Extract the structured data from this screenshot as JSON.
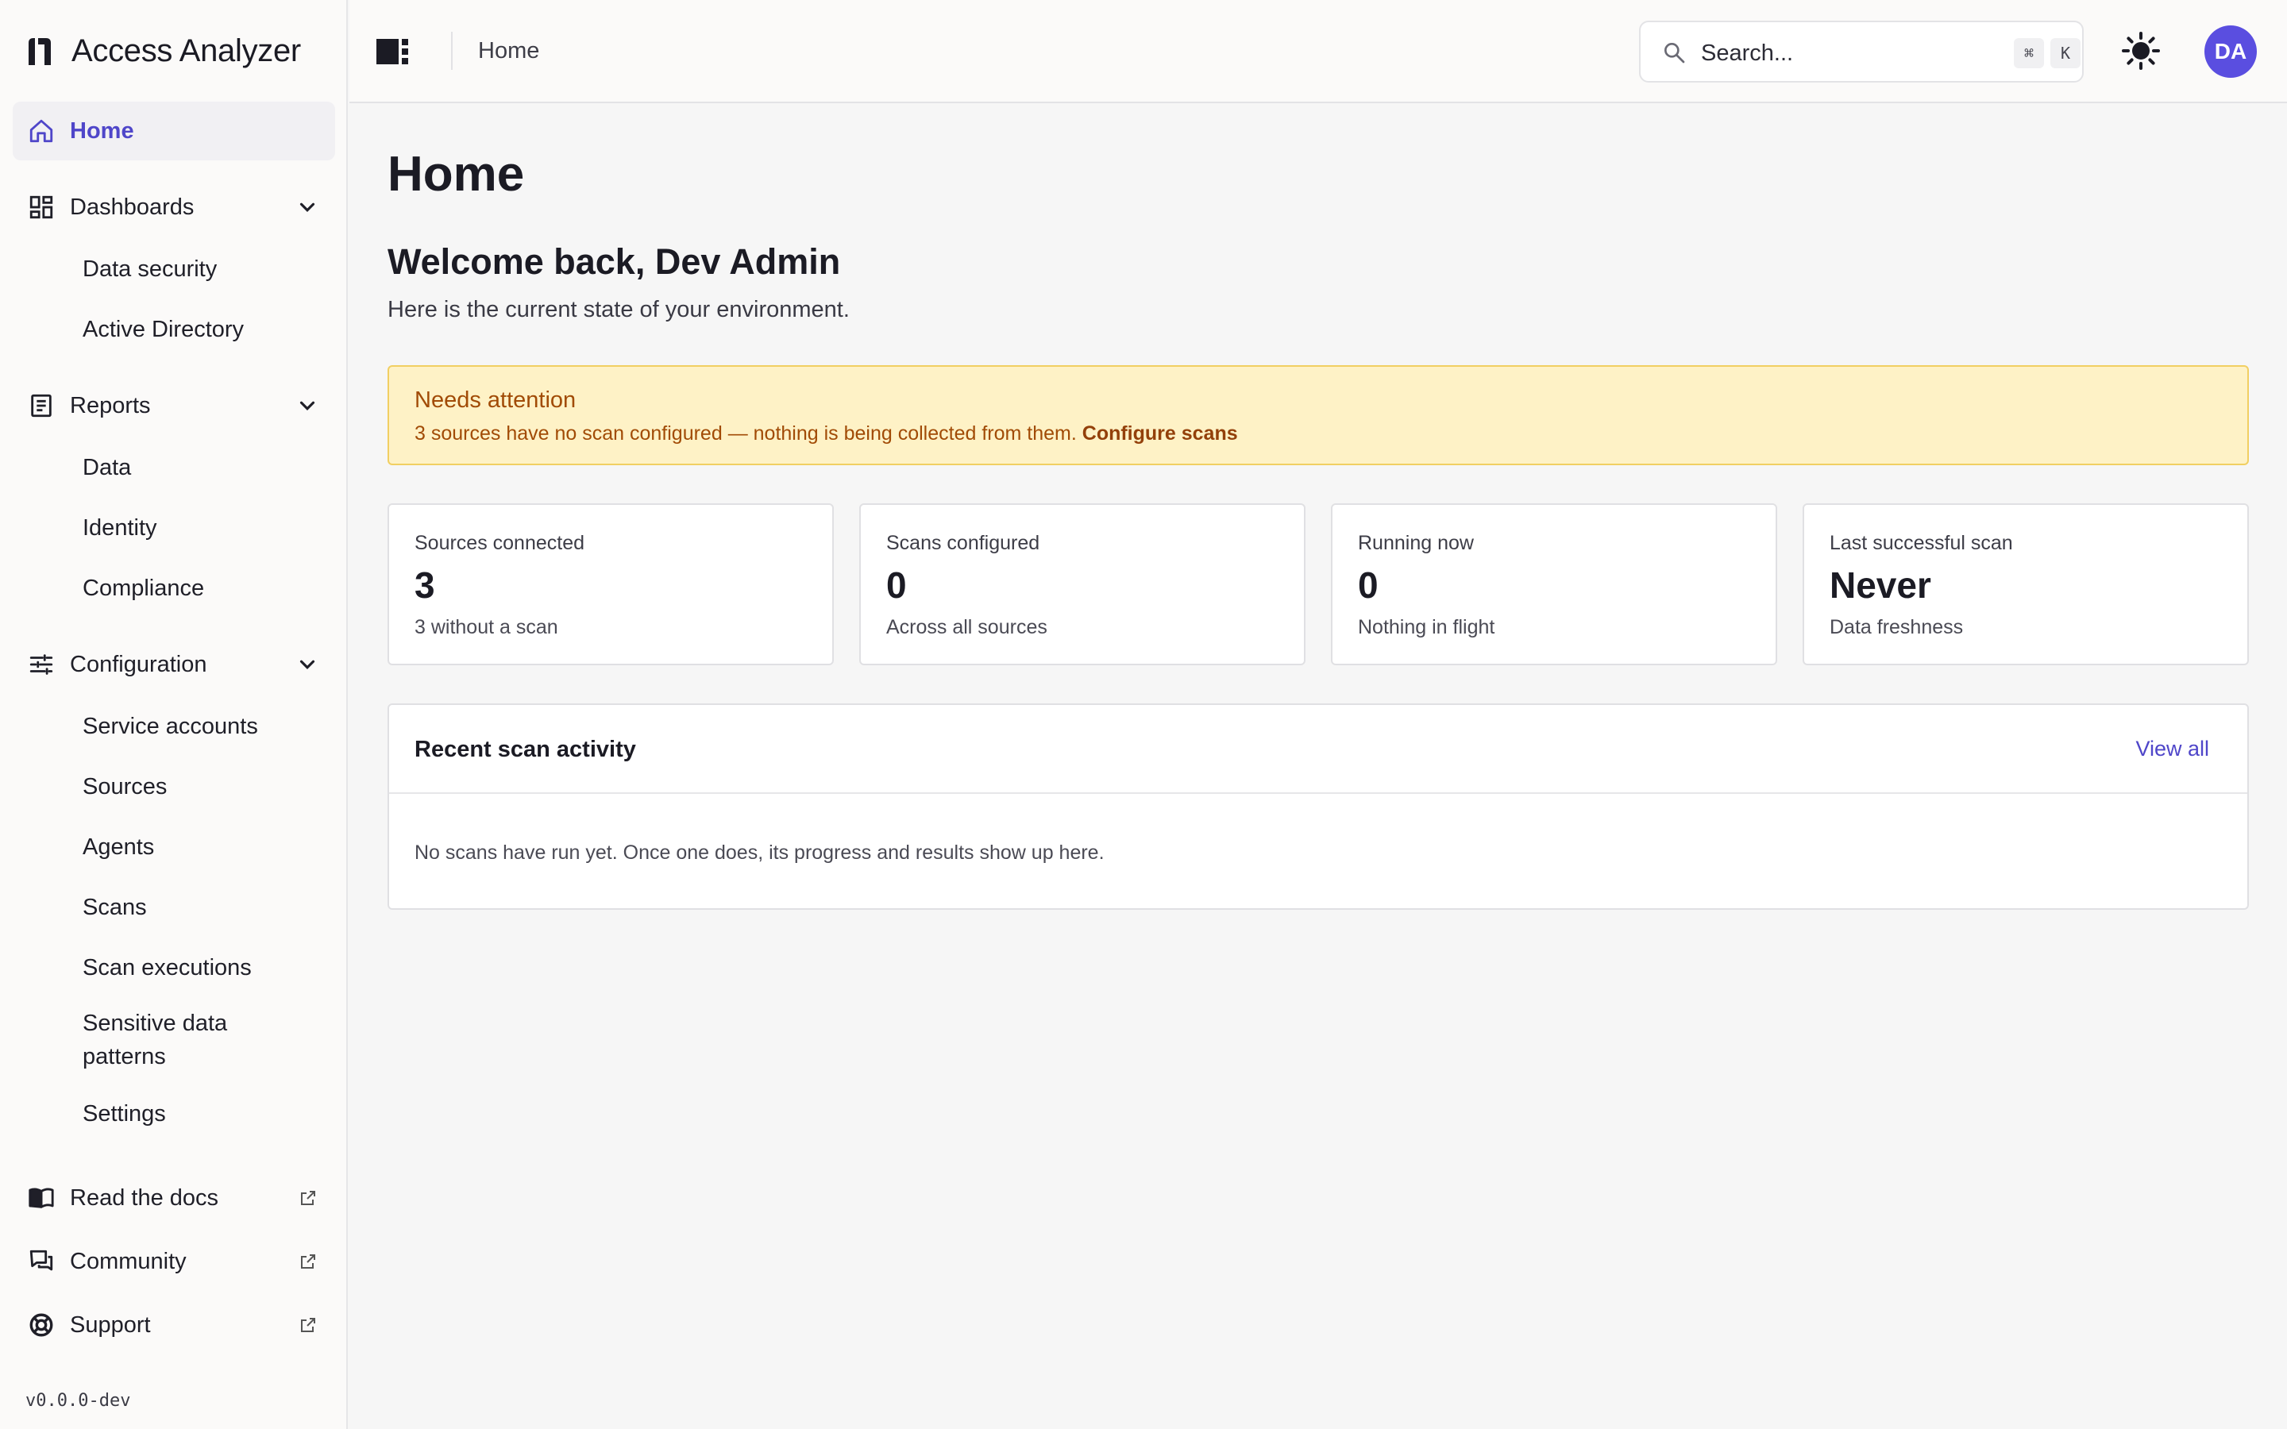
{
  "app": {
    "name": "Access Analyzer",
    "version": "v0.0.0-dev"
  },
  "sidebar": {
    "home": {
      "label": "Home",
      "icon": "home-icon"
    },
    "dashboards": {
      "label": "Dashboards",
      "icon": "dashboard-icon",
      "items": [
        "Data security",
        "Active Directory"
      ]
    },
    "reports": {
      "label": "Reports",
      "icon": "report-icon",
      "items": [
        "Data",
        "Identity",
        "Compliance"
      ]
    },
    "configuration": {
      "label": "Configuration",
      "icon": "sliders-icon",
      "items": [
        "Service accounts",
        "Sources",
        "Agents",
        "Scans",
        "Scan executions",
        "Sensitive data patterns",
        "Settings"
      ]
    },
    "links": [
      {
        "label": "Read the docs",
        "icon": "book-icon"
      },
      {
        "label": "Community",
        "icon": "chat-icon"
      },
      {
        "label": "Support",
        "icon": "lifebuoy-icon"
      }
    ]
  },
  "topbar": {
    "breadcrumb": "Home",
    "search_placeholder": "Search...",
    "shortcut": [
      "⌘",
      "K"
    ],
    "avatar_initials": "DA"
  },
  "main": {
    "title": "Home",
    "welcome": "Welcome back, Dev Admin",
    "welcome_sub": "Here is the current state of your environment.",
    "alert": {
      "title": "Needs attention",
      "text": "3 sources have no scan configured — nothing is being collected from them.",
      "link": "Configure scans"
    },
    "stats": [
      {
        "label": "Sources connected",
        "value": "3",
        "sub": "3 without a scan"
      },
      {
        "label": "Scans configured",
        "value": "0",
        "sub": "Across all sources"
      },
      {
        "label": "Running now",
        "value": "0",
        "sub": "Nothing in flight"
      },
      {
        "label": "Last successful scan",
        "value": "Never",
        "sub": "Data freshness"
      }
    ],
    "activity": {
      "title": "Recent scan activity",
      "view_all": "View all",
      "empty": "No scans have run yet. Once one does, its progress and results show up here."
    }
  },
  "colors": {
    "accent": "#4f46c9",
    "avatar": "#5a4ee0",
    "alert_bg": "#fef2c6",
    "alert_border": "#f1cf62",
    "alert_text": "#a14b06"
  }
}
